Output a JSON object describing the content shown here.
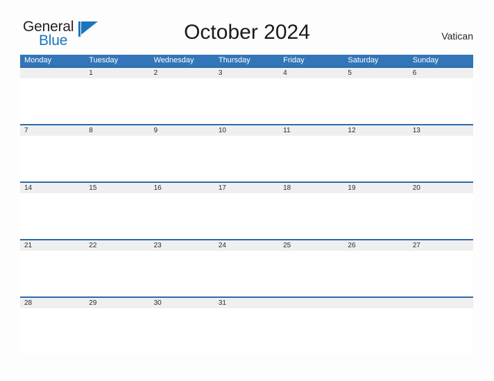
{
  "brand": {
    "name_part1": "General",
    "name_part2": "Blue",
    "mark_icon": "blue-triangle-flag-icon",
    "color_primary": "#1b75bc",
    "color_text": "#231f20"
  },
  "header": {
    "title": "October 2024",
    "region": "Vatican"
  },
  "calendar": {
    "header_bg_color": "#3275b8",
    "row_band_color": "#efefef",
    "row_divider_color": "#2c6aa8",
    "day_names": [
      "Monday",
      "Tuesday",
      "Wednesday",
      "Thursday",
      "Friday",
      "Saturday",
      "Sunday"
    ],
    "weeks": [
      {
        "dates": [
          "",
          "1",
          "2",
          "3",
          "4",
          "5",
          "6"
        ]
      },
      {
        "dates": [
          "7",
          "8",
          "9",
          "10",
          "11",
          "12",
          "13"
        ]
      },
      {
        "dates": [
          "14",
          "15",
          "16",
          "17",
          "18",
          "19",
          "20"
        ]
      },
      {
        "dates": [
          "21",
          "22",
          "23",
          "24",
          "25",
          "26",
          "27"
        ]
      },
      {
        "dates": [
          "28",
          "29",
          "30",
          "31",
          "",
          "",
          ""
        ]
      }
    ]
  }
}
